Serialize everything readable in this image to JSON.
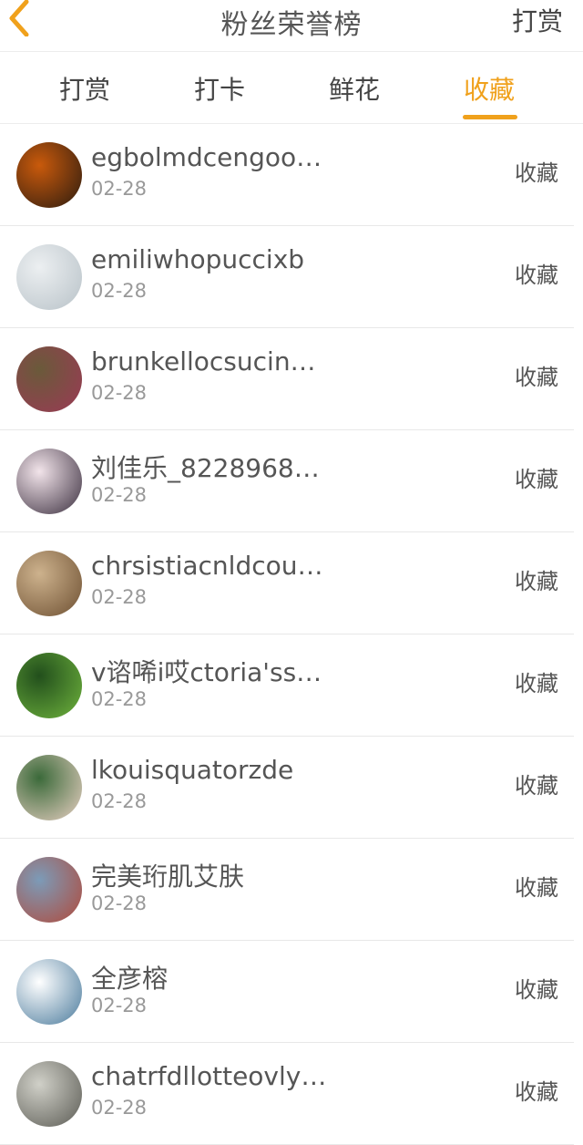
{
  "header": {
    "title": "粉丝荣誉榜",
    "right_action": "打赏"
  },
  "tabs": [
    {
      "label": "打赏",
      "active": false
    },
    {
      "label": "打卡",
      "active": false
    },
    {
      "label": "鲜花",
      "active": false
    },
    {
      "label": "收藏",
      "active": true
    }
  ],
  "colors": {
    "accent": "#f0a11c"
  },
  "list": [
    {
      "name": "egbolmdcengoo…",
      "date": "02-28",
      "action": "收藏",
      "avatar_colors": [
        "#c95a0c",
        "#2b1b0f"
      ]
    },
    {
      "name": "emiliwhopuccixb",
      "date": "02-28",
      "action": "收藏",
      "avatar_colors": [
        "#eceff1",
        "#b8c2c8"
      ]
    },
    {
      "name": "brunkellocsucin…",
      "date": "02-28",
      "action": "收藏",
      "avatar_colors": [
        "#6a5a3a",
        "#9b3a55"
      ]
    },
    {
      "name": "刘佳乐_8228968…",
      "date": "02-28",
      "action": "收藏",
      "avatar_colors": [
        "#f2e4ea",
        "#3b2f3f"
      ]
    },
    {
      "name": "chrsistiacnldcou…",
      "date": "02-28",
      "action": "收藏",
      "avatar_colors": [
        "#cdb28d",
        "#6e5032"
      ]
    },
    {
      "name": "v谘唏i哎ctoria'ss…",
      "date": "02-28",
      "action": "收藏",
      "avatar_colors": [
        "#224f1c",
        "#6fb33d"
      ]
    },
    {
      "name": "lkouisquatorzde",
      "date": "02-28",
      "action": "收藏",
      "avatar_colors": [
        "#3b6a3a",
        "#e9d0c3"
      ]
    },
    {
      "name": "完美珩肌艾肤",
      "date": "02-28",
      "action": "收藏",
      "avatar_colors": [
        "#7c9bb8",
        "#b04a3b"
      ]
    },
    {
      "name": "全彦榕",
      "date": "02-28",
      "action": "收藏",
      "avatar_colors": [
        "#ffffff",
        "#4a7a9c"
      ]
    },
    {
      "name": "chatrfdllotteovly…",
      "date": "02-28",
      "action": "收藏",
      "avatar_colors": [
        "#d0d0c8",
        "#5b5b54"
      ]
    }
  ]
}
